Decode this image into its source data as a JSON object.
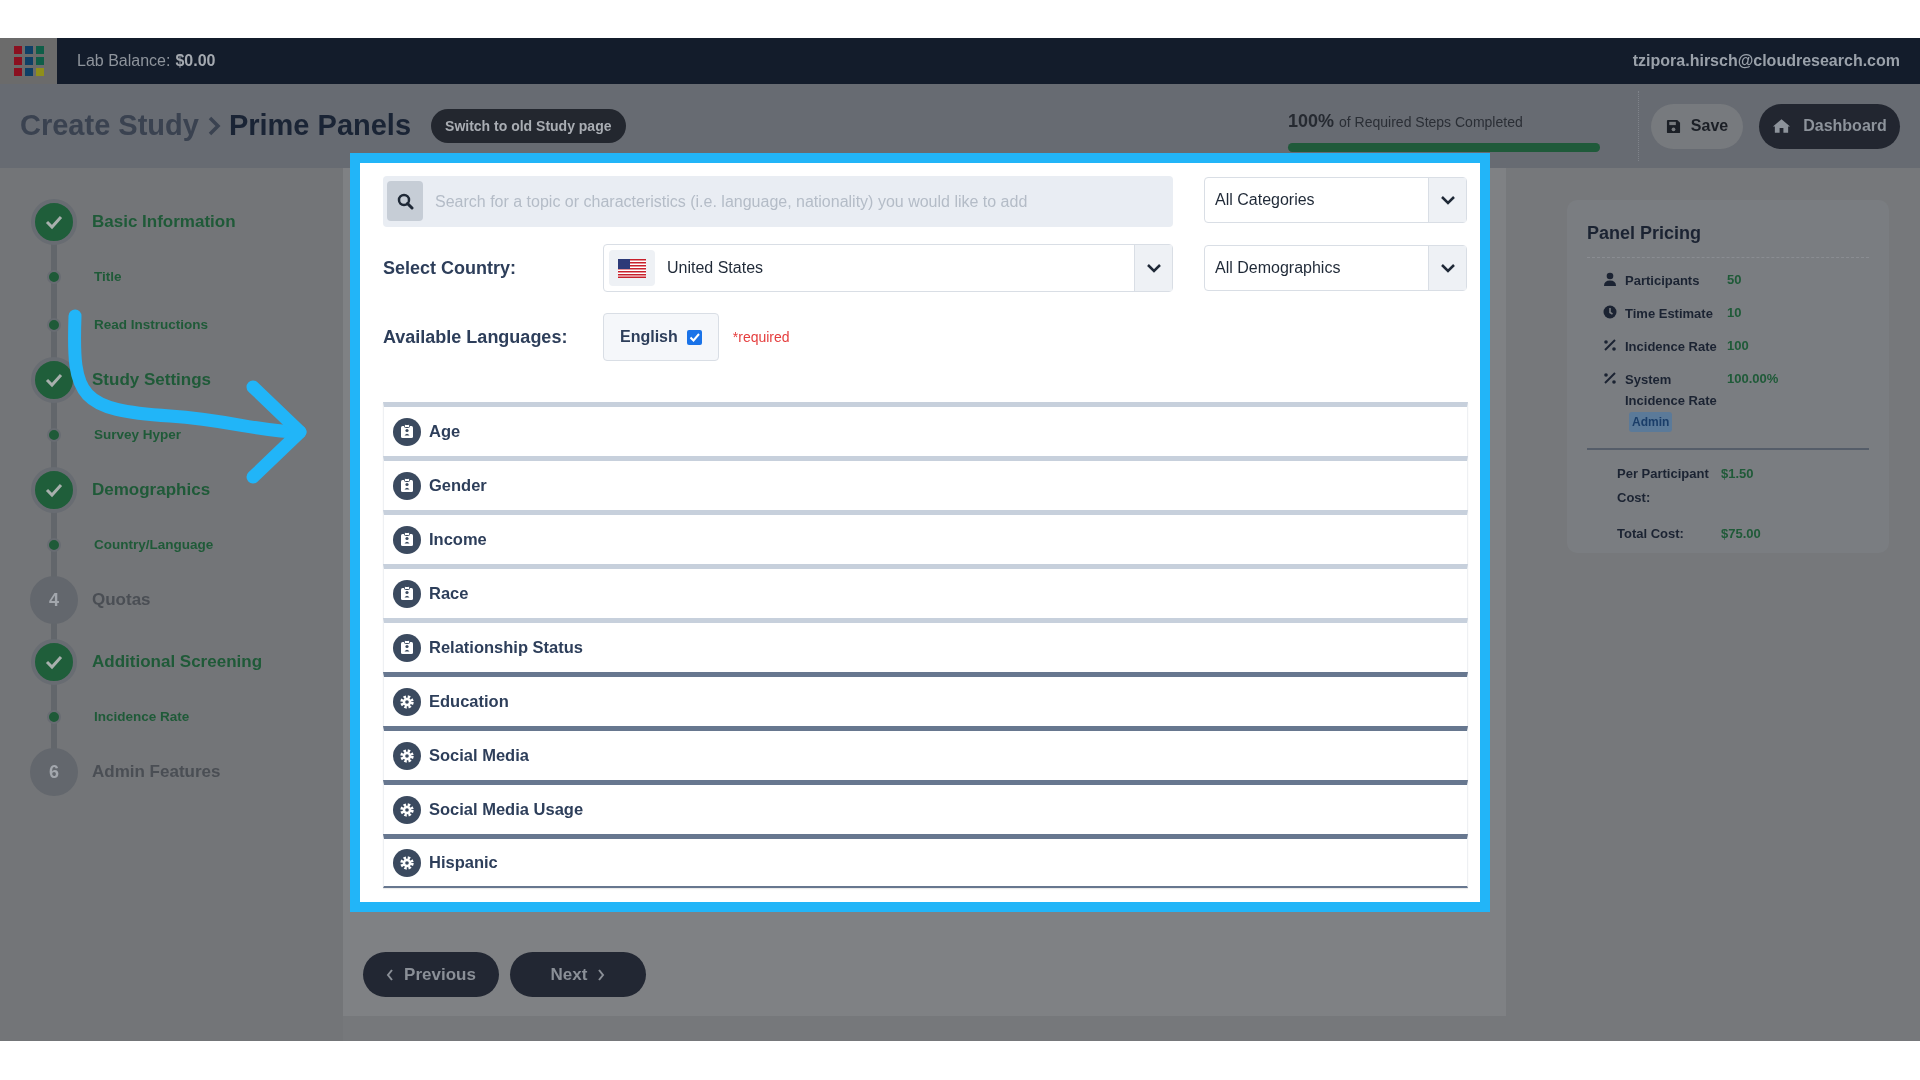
{
  "nav": {
    "balance_label": "Lab Balance:",
    "balance": "$0.00",
    "email": "tzipora.hirsch@cloudresearch.com"
  },
  "header": {
    "breadcrumb": "Create Study",
    "title": "Prime Panels",
    "switch_button": "Switch to old Study page",
    "progress": {
      "percent": "100%",
      "label": "of Required Steps Completed",
      "level": 1
    },
    "save_button": "Save",
    "dashboard_button": "Dashboard"
  },
  "steps": [
    {
      "label": "Basic Information",
      "completed": true,
      "children": [
        {
          "label": "Title"
        },
        {
          "label": "Read Instructions"
        }
      ]
    },
    {
      "label": "Study Settings",
      "completed": true,
      "children": [
        {
          "label": "Survey Hyper"
        }
      ]
    },
    {
      "label": "Demographics",
      "completed": true,
      "children": [
        {
          "label": "Country/Language"
        }
      ]
    },
    {
      "label": "Quotas",
      "completed": false,
      "number": "4"
    },
    {
      "label": "Additional Screening",
      "completed": true,
      "children": [
        {
          "label": "Incidence Rate"
        }
      ]
    },
    {
      "label": "Admin Features",
      "completed": false,
      "number": "6"
    }
  ],
  "form": {
    "search": {
      "placeholder": "Search for a topic or characteristics (i.e. language, nationality) you would like to add"
    },
    "category_select": "All Categories",
    "country_label": "Select Country:",
    "country": "United States",
    "demographics_select": "All Demographics",
    "languages_label": "Available Languages:",
    "languages": [
      {
        "label": "English",
        "checked": true
      }
    ],
    "required_note": "*required",
    "topics": [
      {
        "label": "Age",
        "kind": "profile"
      },
      {
        "label": "Gender",
        "kind": "profile"
      },
      {
        "label": "Income",
        "kind": "profile"
      },
      {
        "label": "Race",
        "kind": "profile"
      },
      {
        "label": "Relationship Status",
        "kind": "profile"
      },
      {
        "label": "Education",
        "kind": "settings"
      },
      {
        "label": "Social Media",
        "kind": "settings"
      },
      {
        "label": "Social Media Usage",
        "kind": "settings"
      },
      {
        "label": "Hispanic",
        "kind": "settings"
      }
    ]
  },
  "footer": {
    "previous": "Previous",
    "next": "Next"
  },
  "pricing": {
    "title": "Panel Pricing",
    "stats": [
      {
        "kind": "participants",
        "label": "Participants",
        "value": "50"
      },
      {
        "kind": "time",
        "label": "Time Estimate",
        "value": "10"
      },
      {
        "kind": "rate",
        "label": "Incidence Rate",
        "value": "100"
      },
      {
        "kind": "rate",
        "label": "System Incidence Rate",
        "value": "100.00%",
        "badge": "Admin"
      }
    ],
    "costs": [
      {
        "label": "Per Participant Cost:",
        "value": "$1.50"
      },
      {
        "label": "Total Cost:",
        "value": "$75.00"
      }
    ]
  }
}
